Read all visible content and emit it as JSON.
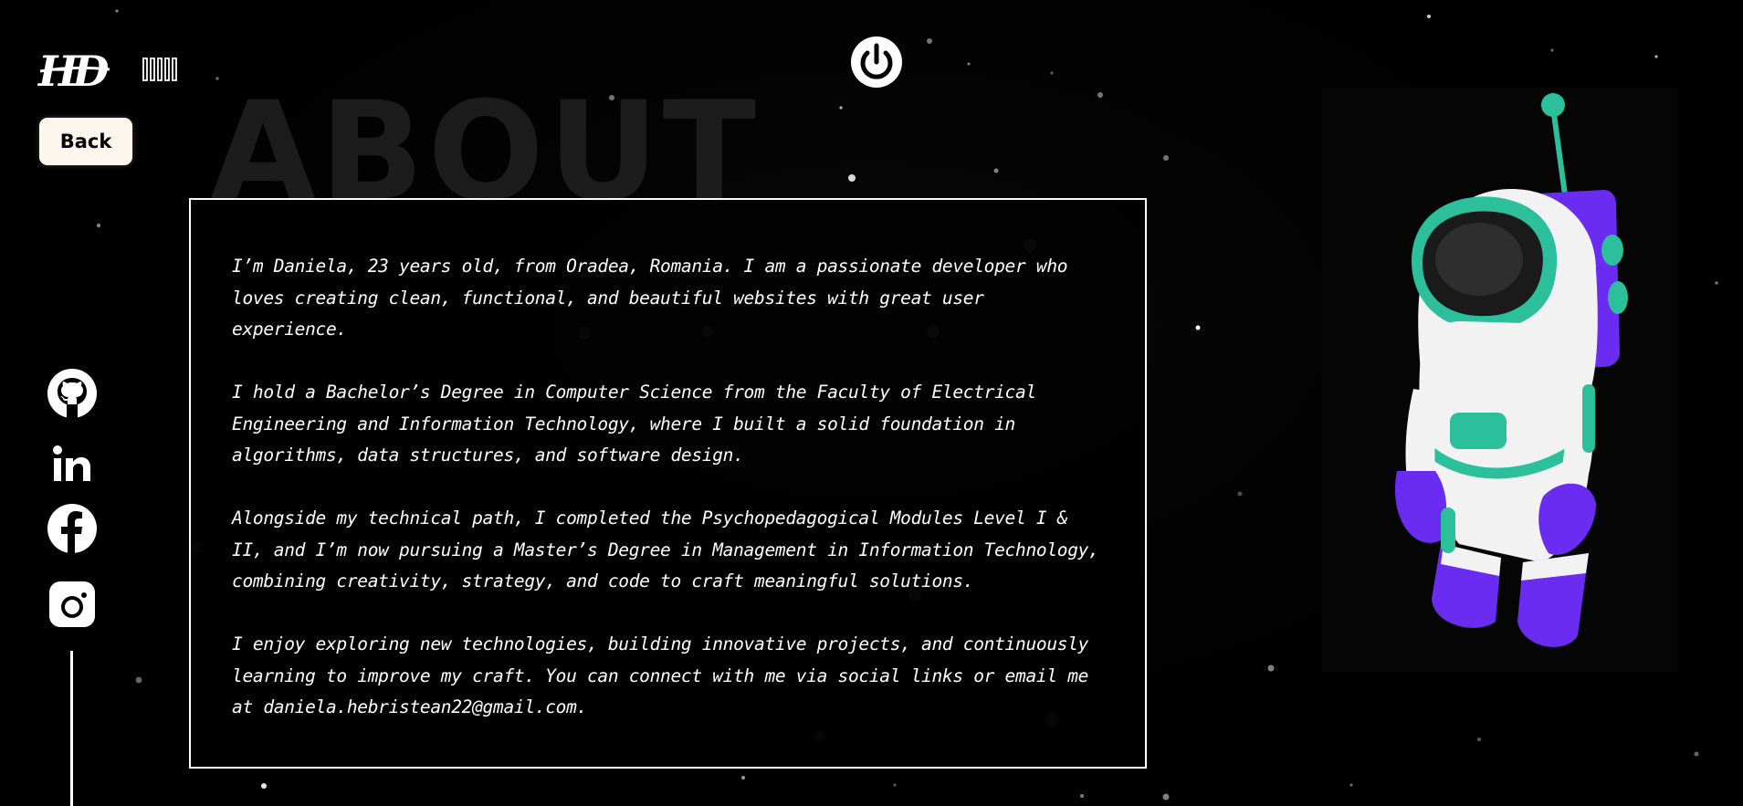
{
  "header": {
    "logo_text": "HD",
    "watermark_title": "ABOUT"
  },
  "nav": {
    "back_label": "Back"
  },
  "social_links": [
    {
      "name": "github",
      "icon": "github-icon"
    },
    {
      "name": "linkedin",
      "icon": "linkedin-icon"
    },
    {
      "name": "facebook",
      "icon": "facebook-icon"
    },
    {
      "name": "instagram",
      "icon": "instagram-icon"
    }
  ],
  "about": {
    "paragraphs": [
      "I’m Daniela, 23 years old, from Oradea, Romania. I am a passionate developer who loves creating clean, functional, and beautiful websites with great user experience.",
      "I hold a Bachelor’s Degree in Computer Science from the Faculty of Electrical Engineering and Information Technology, where I built a solid foundation in algorithms, data structures, and software design.",
      "Alongside my technical path, I completed the Psychopedagogical Modules Level I & II, and I’m now pursuing a Master’s Degree in Management in Information Technology, combining creativity, strategy, and code to craft meaningful solutions.",
      "I enjoy exploring new technologies, building innovative projects, and continuously learning to improve my craft. You can connect with me via social links or email me at daniela.hebristean22@gmail.com."
    ]
  },
  "colors": {
    "background": "#000000",
    "text": "#ffffff",
    "back_button_bg": "#fdf6ef",
    "astronaut_teal": "#2bbf9b",
    "astronaut_purple": "#6a2cf0",
    "suit_white": "#f2f2f2"
  },
  "icons": {
    "power": "power-icon",
    "sound": "sound-bars-icon",
    "astronaut": "astronaut-illustration"
  }
}
